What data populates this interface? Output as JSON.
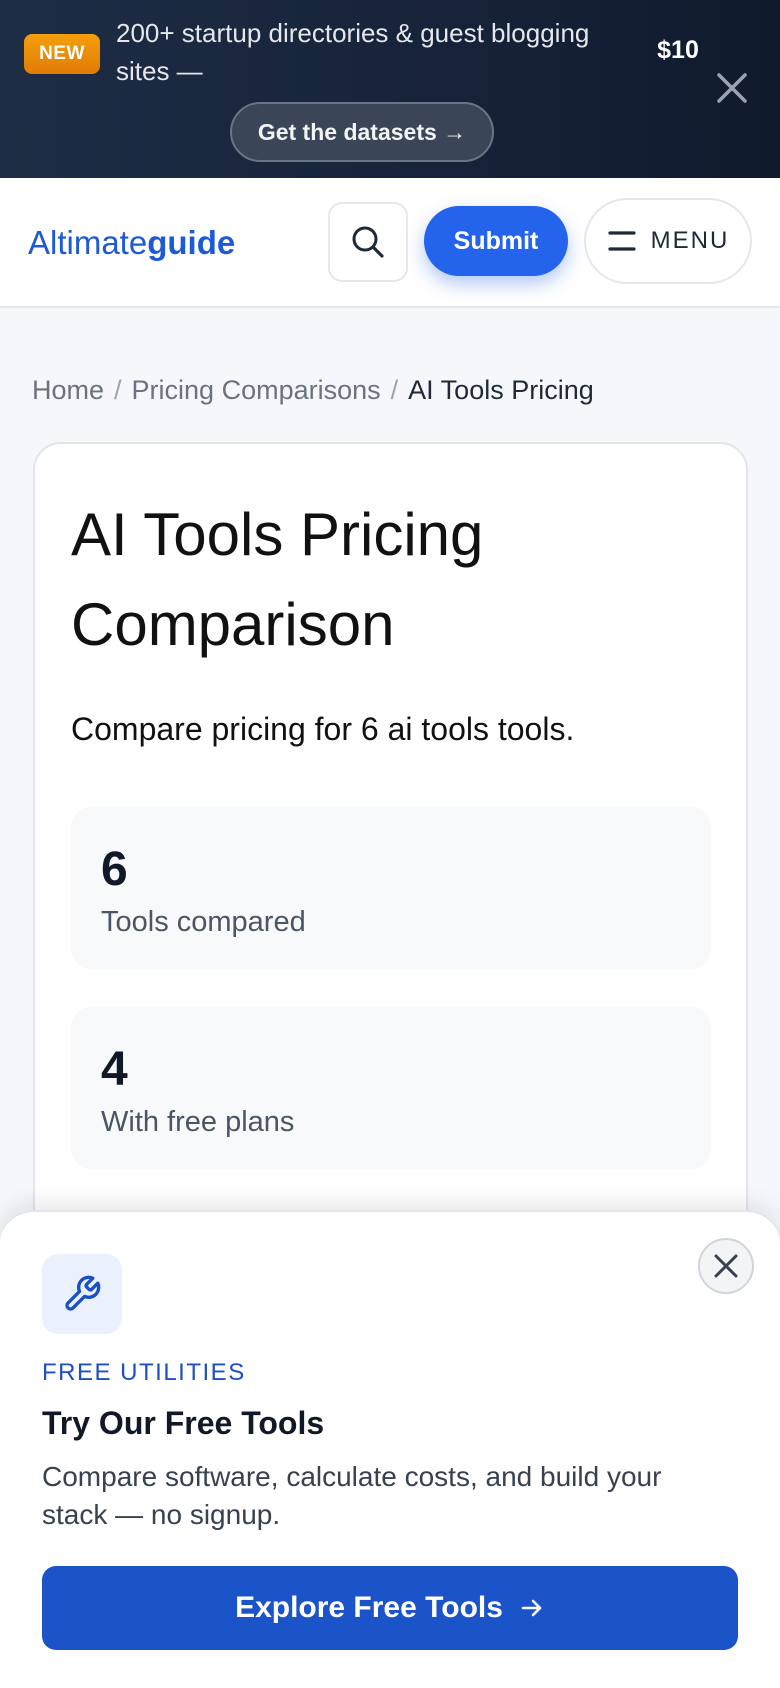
{
  "promo": {
    "badge": "NEW",
    "text": "200+ startup directories & guest blogging sites —",
    "price": "$10",
    "cta": "Get the datasets →"
  },
  "header": {
    "logo_prefix": "Altimate",
    "logo_suffix": "guide",
    "submit_label": "Submit",
    "menu_label": "MENU"
  },
  "breadcrumb": {
    "items": [
      "Home",
      "Pricing Comparisons"
    ],
    "separator": "/",
    "current": "AI Tools Pricing"
  },
  "main": {
    "title": "AI Tools Pricing Comparison",
    "subtitle": "Compare pricing for 6 ai tools tools.",
    "stats": [
      {
        "value": "6",
        "label": "Tools compared"
      },
      {
        "value": "4",
        "label": "With free plans"
      }
    ]
  },
  "sheet": {
    "eyebrow": "FREE UTILITIES",
    "title": "Try Our Free Tools",
    "description": "Compare software, calculate costs, and build your stack — no signup.",
    "cta": "Explore Free Tools"
  },
  "icons": {
    "promo_close": "close-icon",
    "search": "search-icon",
    "menu": "hamburger-icon",
    "sheet_feature": "wrench-icon",
    "sheet_close": "close-icon",
    "cta_arrow": "arrow-right-icon"
  },
  "colors": {
    "brand": "#1d5ad6",
    "submit": "#2463eb",
    "cta": "#1a54c8",
    "badge": "#f59e0b",
    "banner": "#1e2c45"
  }
}
